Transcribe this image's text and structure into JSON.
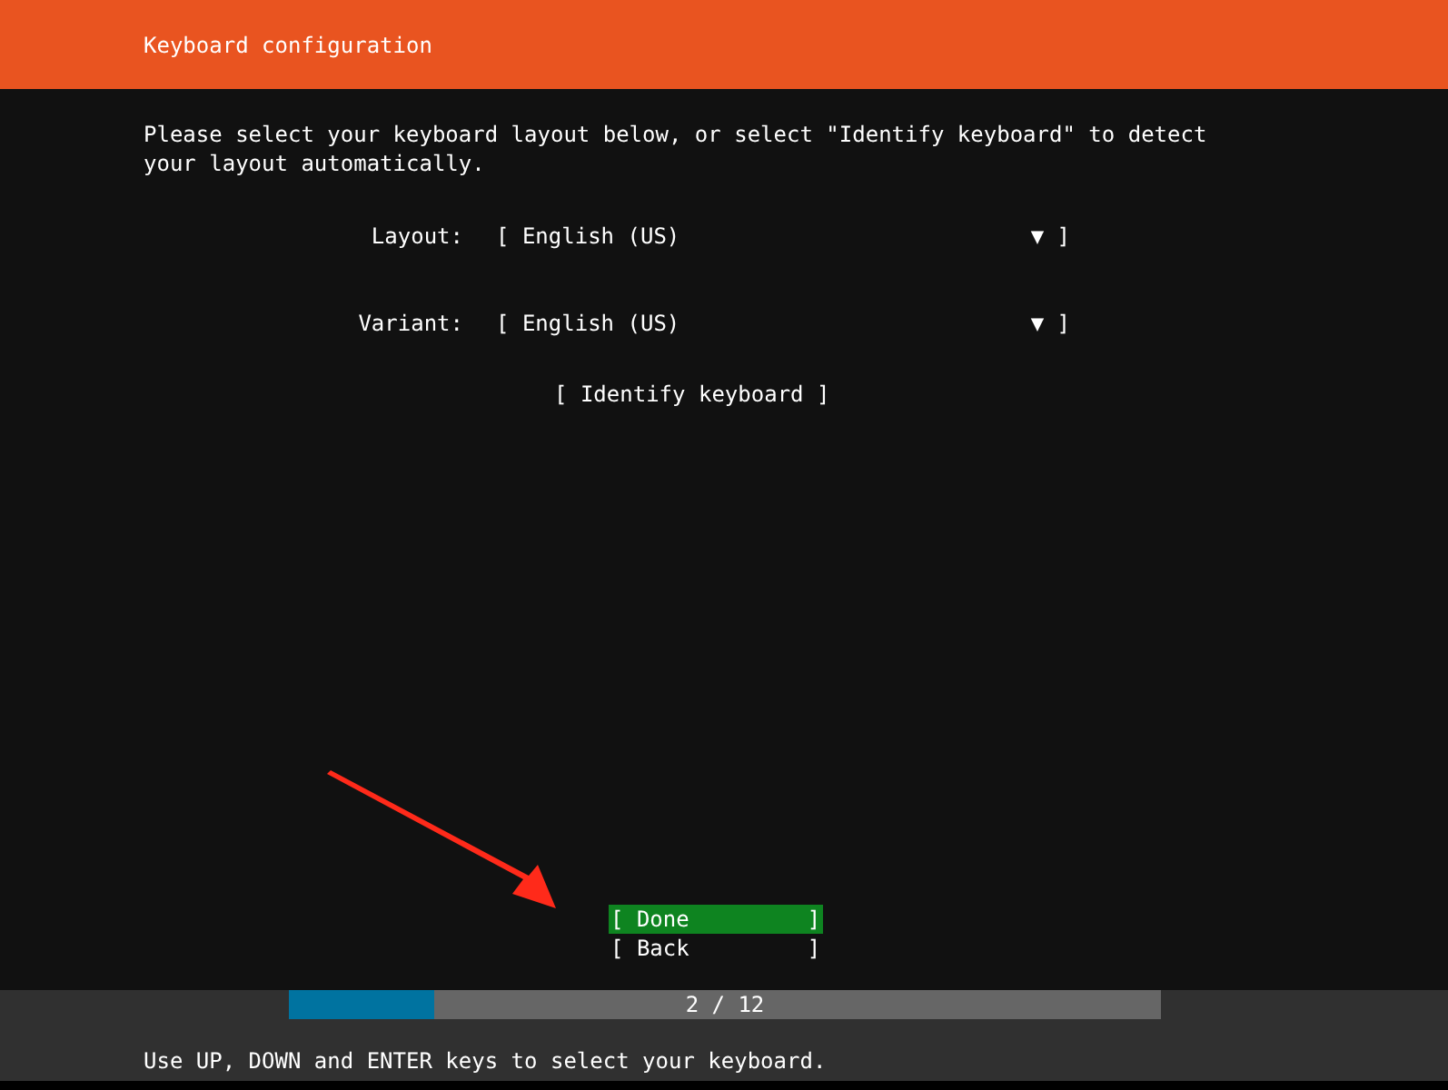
{
  "header": {
    "title": "Keyboard configuration"
  },
  "intro": "Please select your keyboard layout below, or select \"Identify keyboard\" to detect your layout automatically.",
  "fields": [
    {
      "label": "Layout:",
      "value": "[ English (US)",
      "arrow": "▼ ]"
    },
    {
      "label": "Variant:",
      "value": "[ English (US)",
      "arrow": "▼ ]"
    }
  ],
  "identify_button": "[ Identify keyboard ]",
  "buttons": [
    {
      "label": "[ Done         ]",
      "selected": true
    },
    {
      "label": "[ Back         ]",
      "selected": false
    }
  ],
  "progress": {
    "level": 0.1667,
    "text": "2 / 12"
  },
  "hint": "Use UP, DOWN and ENTER keys to select your keyboard."
}
